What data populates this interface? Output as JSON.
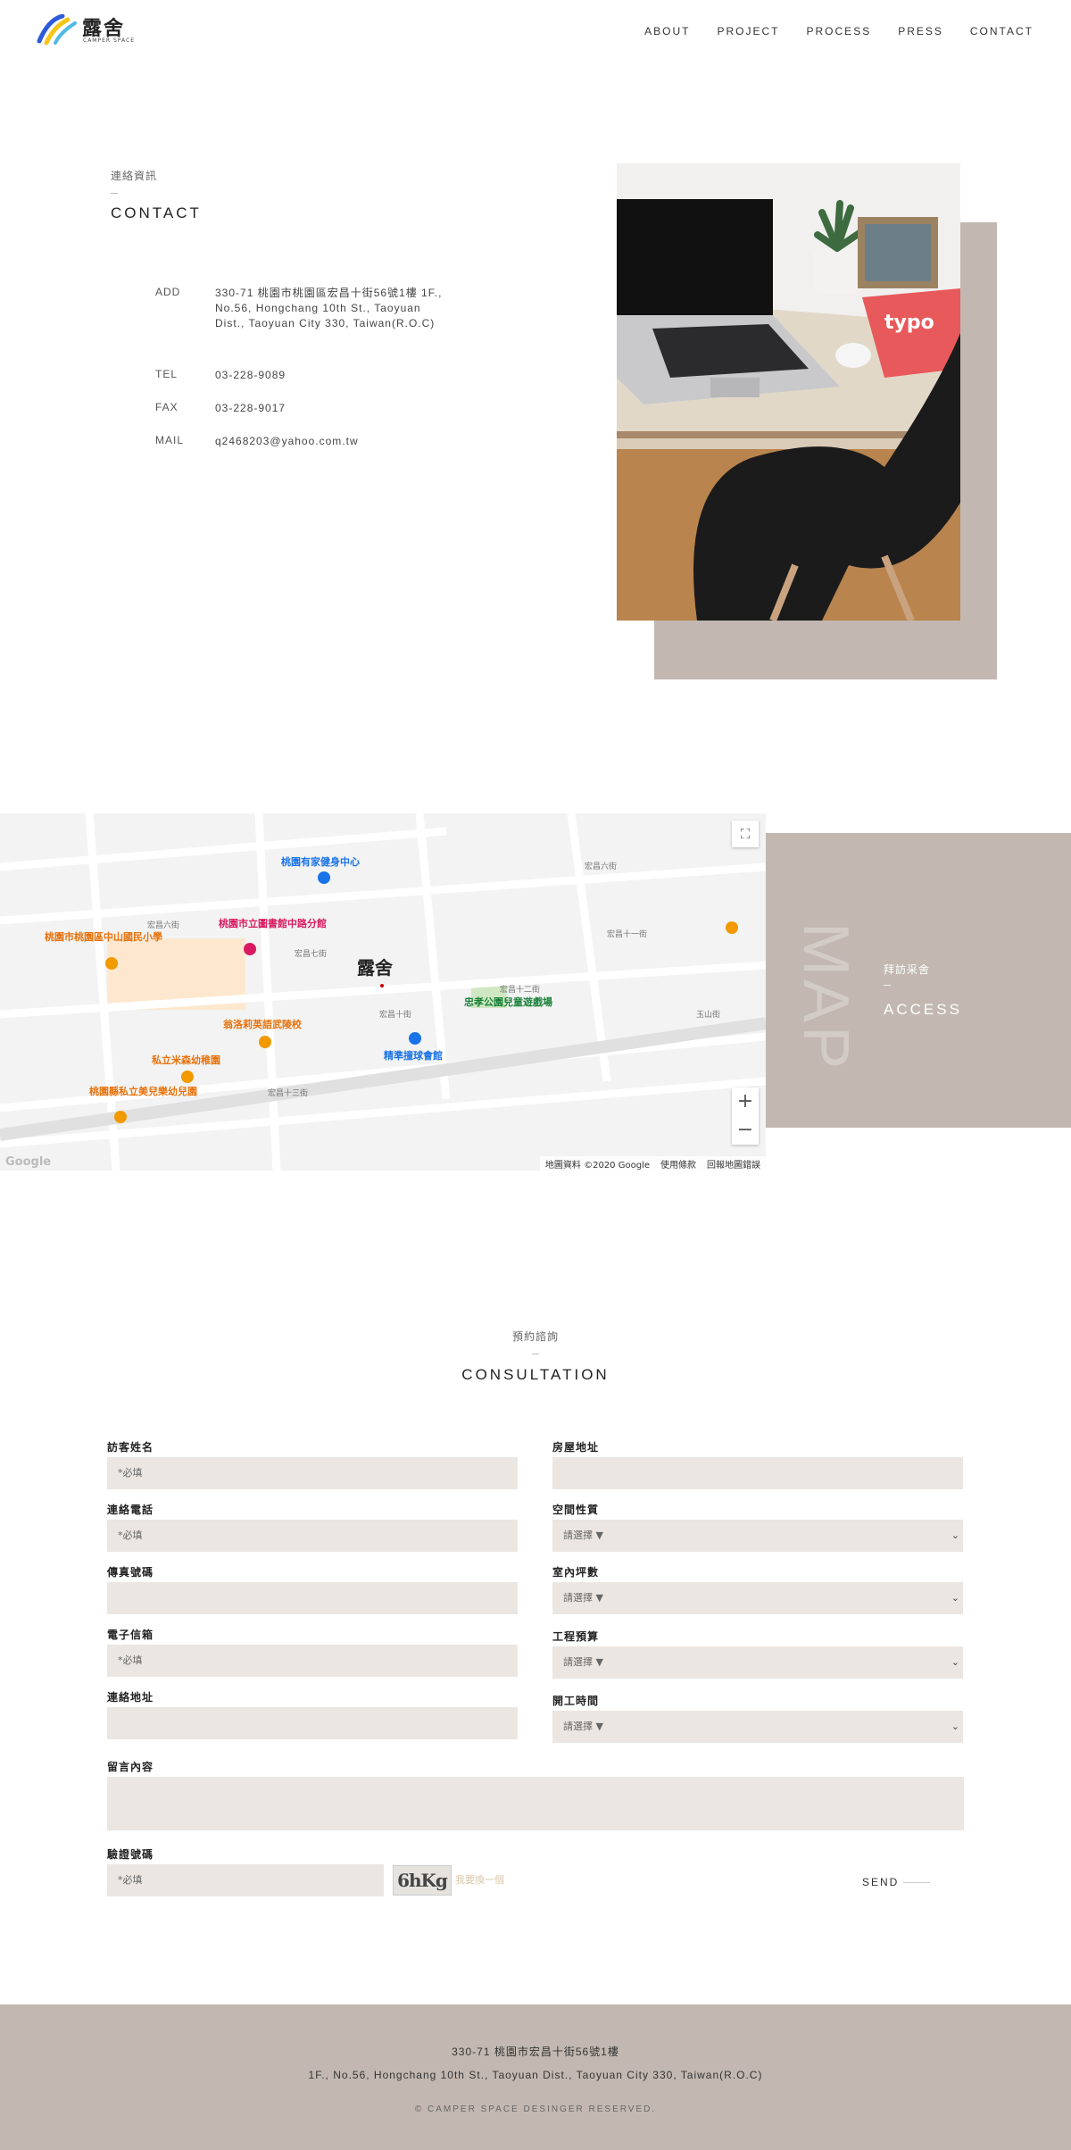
{
  "header": {
    "logo_text": "露舍",
    "logo_sub": "CAMPER SPACE",
    "nav": [
      "ABOUT",
      "PROJECT",
      "PROCESS",
      "PRESS",
      "CONTACT"
    ]
  },
  "contact": {
    "subtitle": "連絡資訊",
    "title": "CONTACT",
    "add_label": "ADD",
    "add_value": "330-71 桃園市桃園區宏昌十街56號1樓 1F., No.56, Hongchang 10th St., Taoyuan Dist., Taoyuan City 330, Taiwan(R.O.C)",
    "tel_label": "TEL",
    "tel_value": "03-228-9089",
    "fax_label": "FAX",
    "fax_value": "03-228-9017",
    "mail_label": "MAIL",
    "mail_value": "q2468203@yahoo.com.tw"
  },
  "map": {
    "marker_label": "露舍",
    "attribution": "地圖資料 ©2020 Google",
    "terms": "使用條款",
    "report": "回報地圖錯誤",
    "google": "Google",
    "fullscreen_icon": "fullscreen-icon",
    "zoom_in": "+",
    "zoom_out": "−",
    "streets": [
      "宏昌六街",
      "宏昌七街",
      "宏昌十街",
      "宏昌十一街",
      "宏昌十二街",
      "宏昌十三街",
      "玉山街"
    ],
    "places": [
      {
        "name": "桃園有家健身中心",
        "color": "#1a73e8"
      },
      {
        "name": "桃園市立圖書館中路分館",
        "color": "#d81b60"
      },
      {
        "name": "桃園市桃園區中山國民小學",
        "color": "#e8710a"
      },
      {
        "name": "翁洛莉英語武陵校",
        "color": "#e8710a"
      },
      {
        "name": "私立米森幼稚園",
        "color": "#e8710a"
      },
      {
        "name": "桃園縣私立美兒樂幼兒園",
        "color": "#e8710a"
      },
      {
        "name": "精準撞球會館",
        "color": "#1a73e8"
      },
      {
        "name": "忠孝公園兒童遊戲場",
        "color": "#188038"
      }
    ]
  },
  "access": {
    "big": "MAP",
    "subtitle": "拜訪采舍",
    "title": "ACCESS"
  },
  "consultation": {
    "subtitle": "預約諮詢",
    "title": "CONSULTATION",
    "fields": {
      "name_label": "訪客姓名",
      "name_placeholder": "*必填",
      "phone_label": "連絡電話",
      "phone_placeholder": "*必填",
      "fax_label": "傳真號碼",
      "fax_placeholder": "",
      "email_label": "電子信箱",
      "email_placeholder": "*必填",
      "address_label": "連絡地址",
      "address_placeholder": "",
      "house_label": "房屋地址",
      "house_placeholder": "",
      "space_label": "空間性質",
      "space_value": "請選擇 ▼",
      "area_label": "室內坪數",
      "area_value": "請選擇 ▼",
      "budget_label": "工程預算",
      "budget_value": "請選擇 ▼",
      "start_label": "開工時間",
      "start_value": "請選擇 ▼",
      "message_label": "留言內容",
      "captcha_label": "驗證號碼",
      "captcha_placeholder": "*必填",
      "captcha_code": "6hKg",
      "captcha_refresh": "我要換一個",
      "send": "SEND"
    }
  },
  "footer": {
    "address_zh": "330-71 桃園市宏昌十街56號1樓",
    "address_en": "1F., No.56, Hongchang 10th St., Taoyuan Dist., Taoyuan City 330, Taiwan(R.O.C)",
    "copyright": "© CAMPER SPACE DESINGER RESERVED."
  }
}
